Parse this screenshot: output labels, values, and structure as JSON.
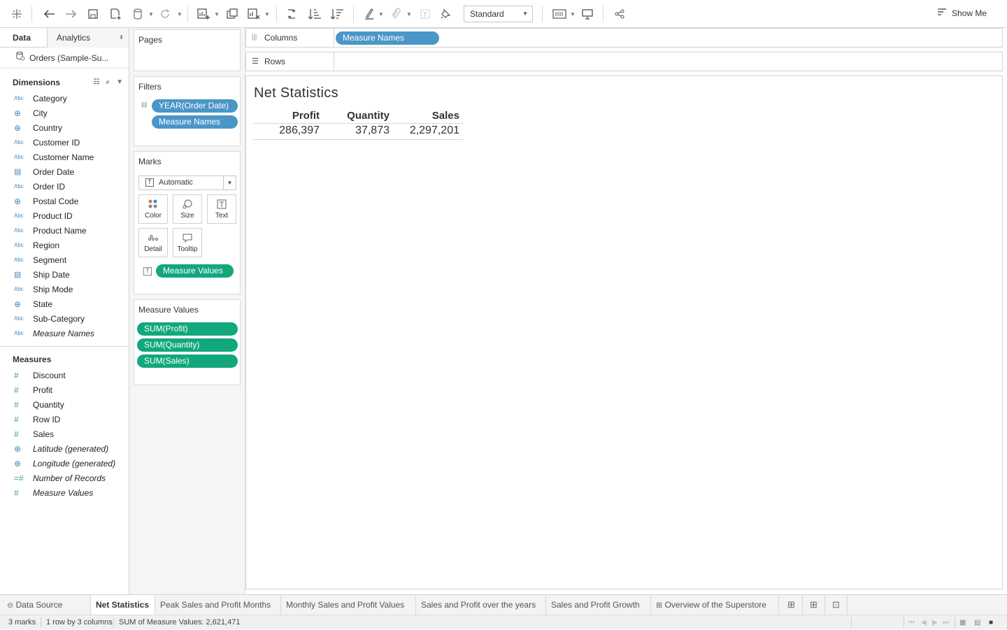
{
  "toolbar": {
    "style_select": "Standard",
    "show_me": "Show Me"
  },
  "left_pane": {
    "tab_data": "Data",
    "tab_analytics": "Analytics",
    "datasource": "Orders (Sample-Su...",
    "dimensions_title": "Dimensions",
    "dimensions": [
      {
        "type": "Abc",
        "name": "Category"
      },
      {
        "type": "globe",
        "name": "City"
      },
      {
        "type": "globe",
        "name": "Country"
      },
      {
        "type": "Abc",
        "name": "Customer ID"
      },
      {
        "type": "Abc",
        "name": "Customer Name"
      },
      {
        "type": "calendar",
        "name": "Order Date"
      },
      {
        "type": "Abc",
        "name": "Order ID"
      },
      {
        "type": "globe",
        "name": "Postal Code"
      },
      {
        "type": "Abc",
        "name": "Product ID"
      },
      {
        "type": "Abc",
        "name": "Product Name"
      },
      {
        "type": "Abc",
        "name": "Region"
      },
      {
        "type": "Abc",
        "name": "Segment"
      },
      {
        "type": "calendar",
        "name": "Ship Date"
      },
      {
        "type": "Abc",
        "name": "Ship Mode"
      },
      {
        "type": "globe",
        "name": "State"
      },
      {
        "type": "Abc",
        "name": "Sub-Category"
      },
      {
        "type": "Abc",
        "name": "Measure Names"
      }
    ],
    "measures_title": "Measures",
    "measures": [
      {
        "type": "#",
        "name": "Discount"
      },
      {
        "type": "#",
        "name": "Profit"
      },
      {
        "type": "#",
        "name": "Quantity"
      },
      {
        "type": "#",
        "name": "Row ID"
      },
      {
        "type": "#",
        "name": "Sales"
      },
      {
        "type": "globe",
        "name": "Latitude (generated)"
      },
      {
        "type": "globe",
        "name": "Longitude (generated)"
      },
      {
        "type": "=#",
        "name": "Number of Records"
      },
      {
        "type": "#",
        "name": "Measure Values"
      }
    ]
  },
  "cards": {
    "pages_title": "Pages",
    "filters_title": "Filters",
    "filters": [
      "YEAR(Order Date)",
      "Measure Names"
    ],
    "marks_title": "Marks",
    "marks_type": "Automatic",
    "mark_buttons": {
      "color": "Color",
      "size": "Size",
      "text": "Text",
      "detail": "Detail",
      "tooltip": "Tooltip"
    },
    "marks_pill": "Measure Values",
    "measure_values_title": "Measure Values",
    "measure_values": [
      "SUM(Profit)",
      "SUM(Quantity)",
      "SUM(Sales)"
    ]
  },
  "shelves": {
    "columns_label": "Columns",
    "columns_pill": "Measure Names",
    "rows_label": "Rows"
  },
  "viz": {
    "title": "Net Statistics",
    "headers": [
      "Profit",
      "Quantity",
      "Sales"
    ],
    "values": [
      "286,397",
      "37,873",
      "2,297,201"
    ]
  },
  "tabs": {
    "data_source": "Data Source",
    "sheets": [
      "Net Statistics",
      "Peak Sales and Profit Months",
      "Monthly Sales and Profit Values",
      "Sales and Profit over the years",
      "Sales and Profit Growth",
      "Overview of the Superstore"
    ],
    "active": "Net Statistics"
  },
  "status": {
    "marks": "3 marks",
    "rows_cols": "1 row by 3 columns",
    "sum": "SUM of Measure Values: 2,621,471"
  }
}
